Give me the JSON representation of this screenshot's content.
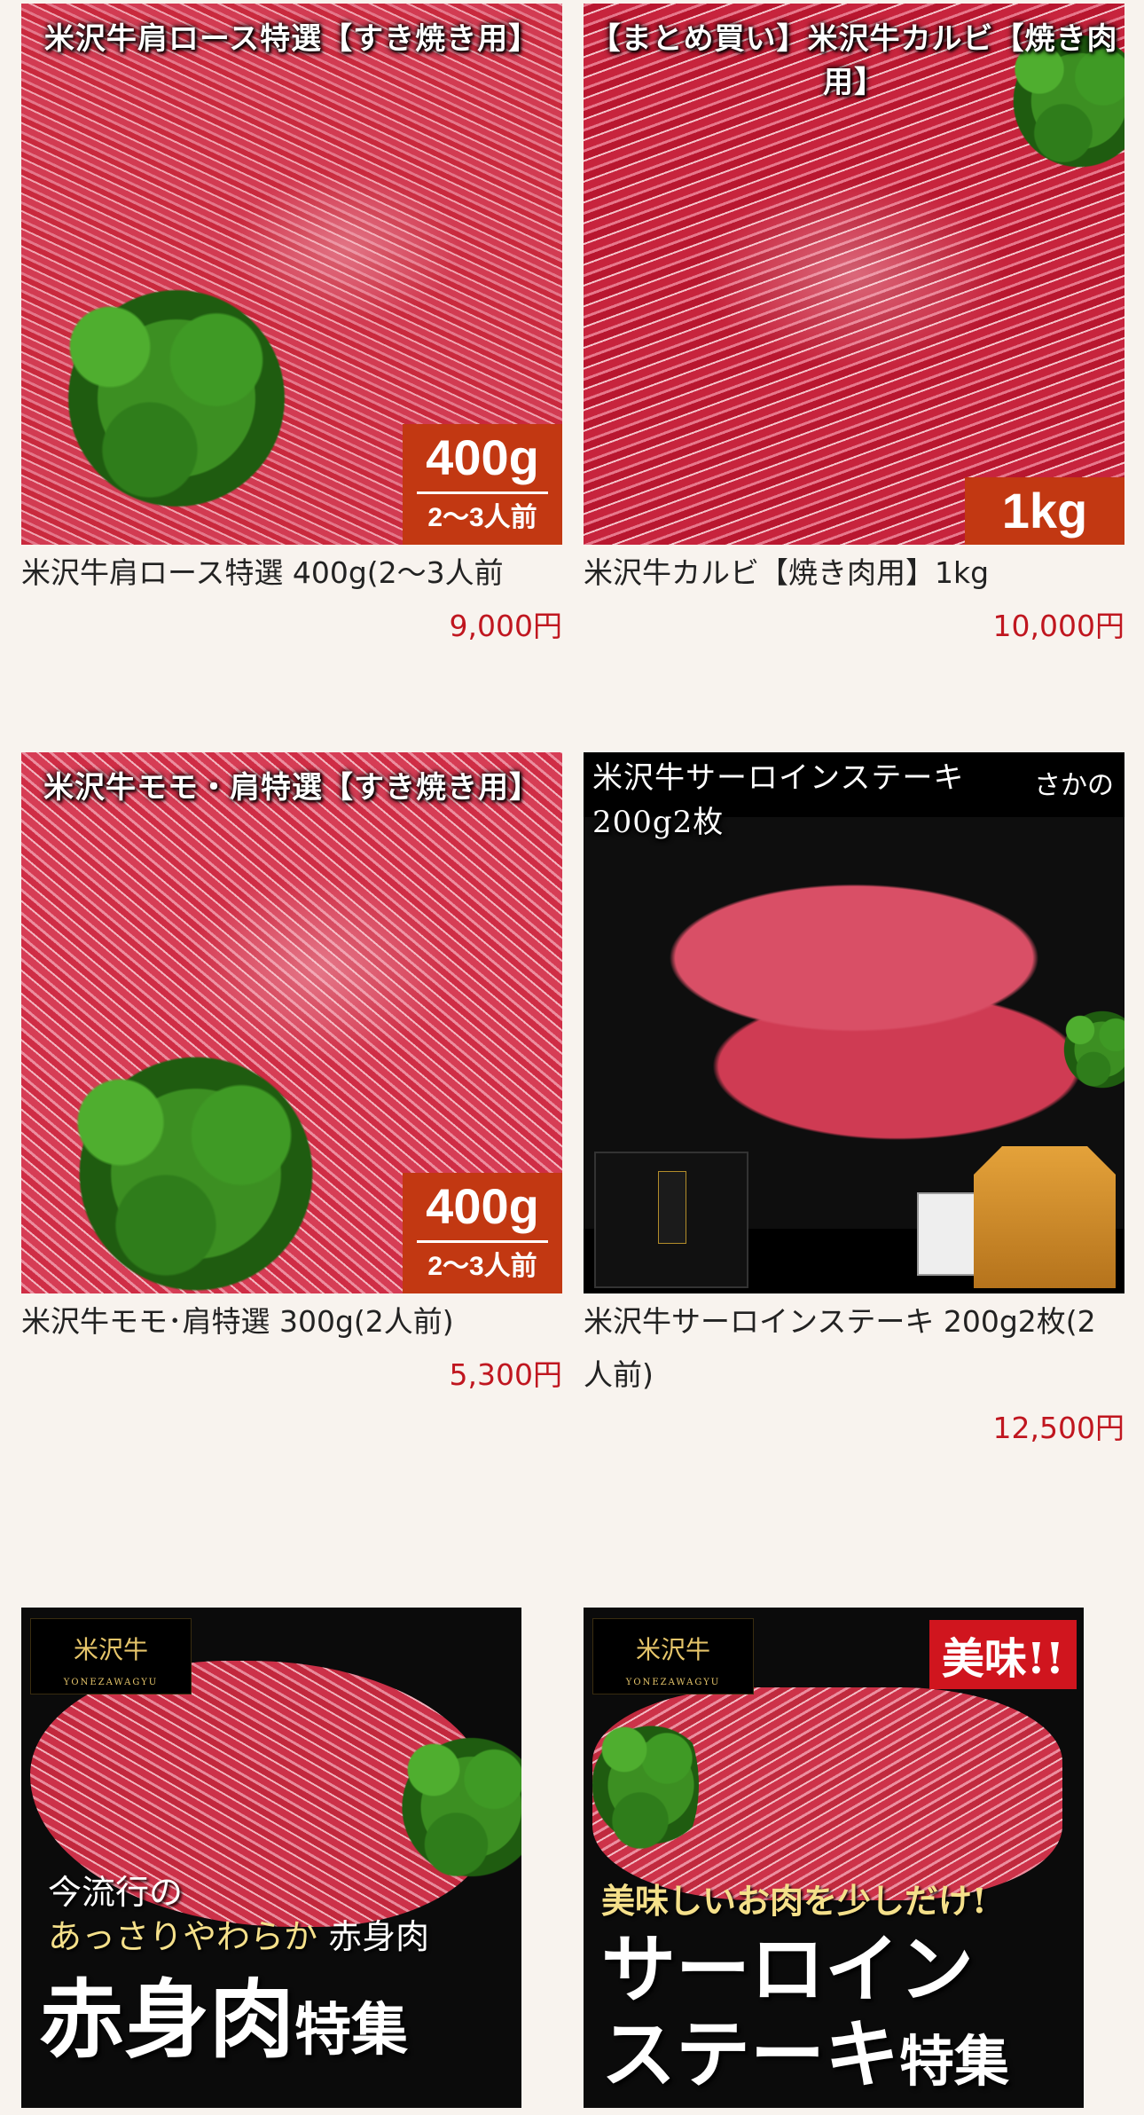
{
  "products": [
    {
      "image_title": "米沢牛肩ロース特選【すき焼き用】",
      "badge_weight": "400g",
      "badge_servings": "2〜3人前",
      "name": "米沢牛肩ロース特選 400g(2〜3人前",
      "price": "9,000円"
    },
    {
      "image_title": "【まとめ買い】米沢牛カルビ【焼き肉用】",
      "badge_weight": "1kg",
      "name": "米沢牛カルビ【焼き肉用】1kg",
      "price": "10,000円"
    },
    {
      "image_title": "米沢牛モモ・肩特選【すき焼き用】",
      "badge_weight": "400g",
      "badge_servings": "2〜3人前",
      "name": "米沢牛モモ･肩特選 300g(2人前)",
      "price": "5,300円"
    },
    {
      "image_title_line1": "米沢牛サーロインステーキ",
      "image_title_line2": "200g2枚",
      "image_brand": "さかの",
      "name": "米沢牛サーロインステーキ 200g2枚(2人前)",
      "price": "12,500円"
    }
  ],
  "banners": [
    {
      "brand": "米沢牛",
      "brand_sub": "YONEZAWAGYU",
      "line1": "今流行の",
      "line2_a": "あっさりやわらか",
      "line2_b": "赤身肉",
      "big": "赤身肉",
      "big_suffix": "特集"
    },
    {
      "brand": "米沢牛",
      "brand_sub": "YONEZAWAGYU",
      "tag": "美味!!",
      "catch": "美味しいお肉を少しだけ!",
      "big_line1": "サーロイン",
      "big_line2": "ステーキ",
      "big_suffix": "特集"
    }
  ],
  "colors": {
    "background": "#f8f3ee",
    "price": "#c0161f",
    "badge": "#c23812"
  }
}
